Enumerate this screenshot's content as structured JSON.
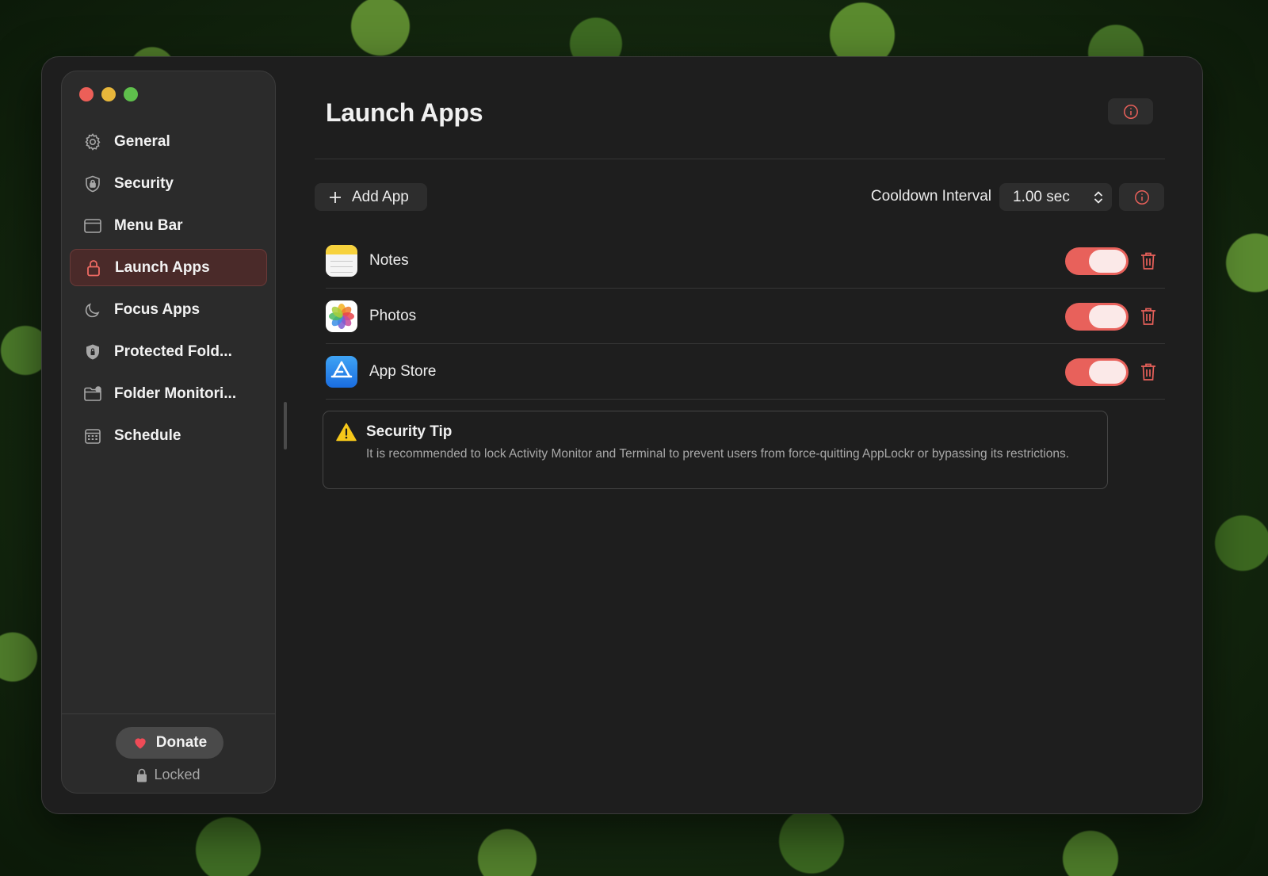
{
  "window": {
    "title": "Launch Apps"
  },
  "sidebar": {
    "items": [
      {
        "label": "General",
        "icon": "gear-icon"
      },
      {
        "label": "Security",
        "icon": "shield-icon"
      },
      {
        "label": "Menu Bar",
        "icon": "window-icon"
      },
      {
        "label": "Launch Apps",
        "icon": "lock-icon",
        "active": true
      },
      {
        "label": "Focus Apps",
        "icon": "moon-icon"
      },
      {
        "label": "Protected Fold...",
        "icon": "shield-lock-icon"
      },
      {
        "label": "Folder Monitori...",
        "icon": "folder-badge-icon"
      },
      {
        "label": "Schedule",
        "icon": "calendar-icon"
      }
    ],
    "footer": {
      "donate_label": "Donate",
      "status_label": "Locked"
    }
  },
  "toolbar": {
    "add_app_label": "Add App",
    "cooldown_label": "Cooldown Interval",
    "cooldown_value": "1.00 sec"
  },
  "apps": [
    {
      "name": "Notes",
      "enabled": true
    },
    {
      "name": "Photos",
      "enabled": true
    },
    {
      "name": "App Store",
      "enabled": true
    }
  ],
  "tip": {
    "title": "Security Tip",
    "body": "It is recommended to lock Activity Monitor and Terminal to prevent users from force-quitting AppLockr or bypassing its restrictions."
  },
  "colors": {
    "accent": "#e8615b",
    "window_bg": "#1e1e1e",
    "sidebar_bg": "#2b2b2b",
    "active_bg": "#4a2a29"
  }
}
